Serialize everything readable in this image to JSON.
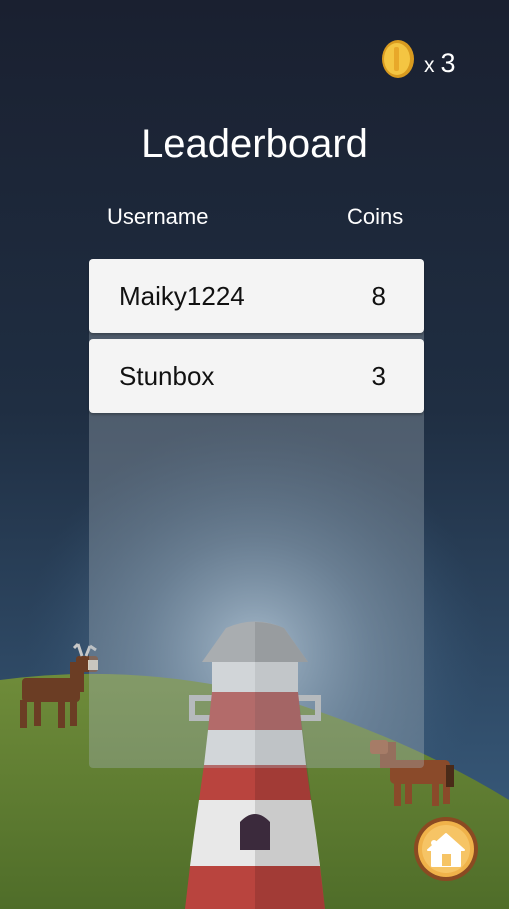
{
  "hud": {
    "coin_prefix": "x",
    "coin_count": "3"
  },
  "leaderboard": {
    "title": "Leaderboard",
    "columns": {
      "username": "Username",
      "coins": "Coins"
    },
    "rows": [
      {
        "username": "Maiky1224",
        "coins": "8"
      },
      {
        "username": "Stunbox",
        "coins": "3"
      }
    ]
  },
  "icons": {
    "coin": "coin-icon",
    "home": "home-icon"
  }
}
